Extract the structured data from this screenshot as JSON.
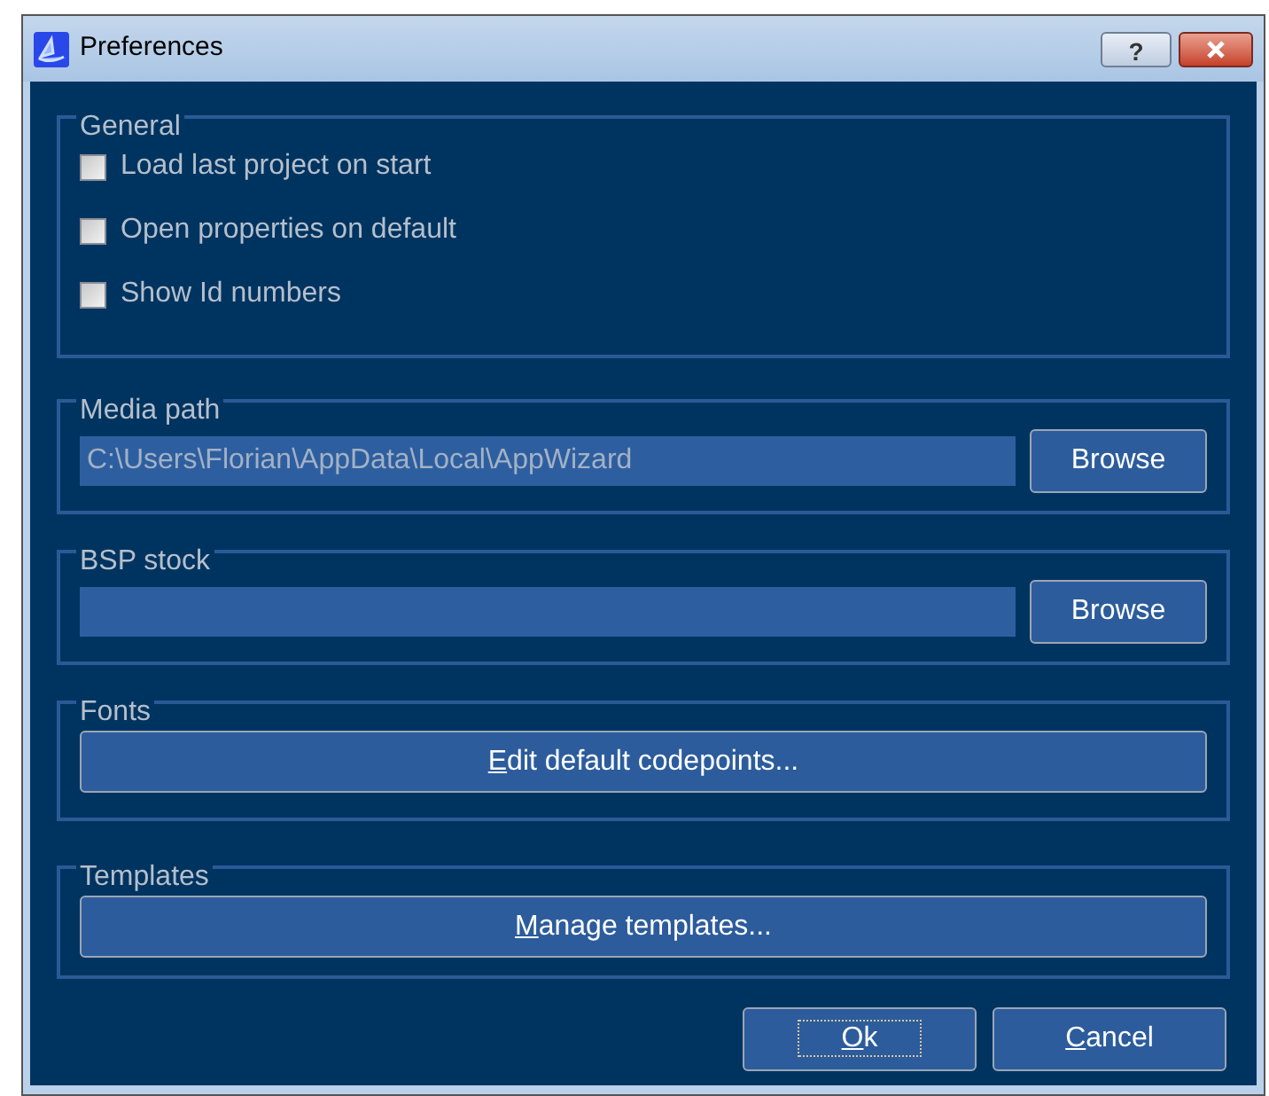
{
  "window": {
    "title": "Preferences",
    "buttons": [
      {
        "kind": "help",
        "label": "?"
      },
      {
        "kind": "close"
      }
    ]
  },
  "general": {
    "title": "General",
    "options": [
      {
        "label": "Load last project on start",
        "checked": false
      },
      {
        "label": "Open properties on default",
        "checked": false
      },
      {
        "label": "Show Id numbers",
        "checked": false
      }
    ]
  },
  "media_path": {
    "title": "Media path",
    "value": "C:\\Users\\Florian\\AppData\\Local\\AppWizard",
    "button": {
      "rest": "Browse"
    }
  },
  "bsp_stock": {
    "title": "BSP stock",
    "button": {
      "rest": "Browse"
    }
  },
  "fonts": {
    "title": "Fonts",
    "button": {
      "mnemonic": "E",
      "rest": "dit default codepoints..."
    }
  },
  "templates": {
    "title": "Templates",
    "button": {
      "mnemonic": "M",
      "rest": "anage templates..."
    }
  },
  "footer": [
    {
      "mnemonic": "O",
      "rest": "k",
      "focused": true
    },
    {
      "mnemonic": "C",
      "rest": "ancel",
      "focused": false
    }
  ]
}
